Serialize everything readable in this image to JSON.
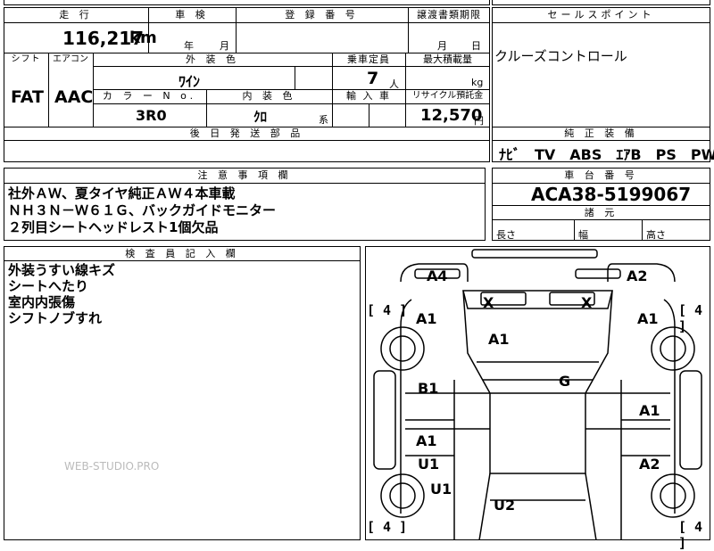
{
  "header": {
    "mileage_label": "走 行",
    "inspection_label": "車 検",
    "registration_label": "登 録 番 号",
    "transfer_deadline_label": "譲渡書類期限",
    "sales_point_label": "セールスポイント"
  },
  "values": {
    "mileage": "116,217",
    "mileage_unit": "km",
    "inspection_year_unit": "年",
    "inspection_month_unit": "月",
    "transfer_month_unit": "月",
    "transfer_day_unit": "日",
    "sales_point": "クルーズコントロール"
  },
  "row2": {
    "shift_label": "シフト",
    "aircon_label": "エアコン",
    "exterior_color_label": "外 装 色",
    "capacity_label": "乗車定員",
    "max_load_label": "最大積載量",
    "shift": "FAT",
    "aircon": "AAC",
    "exterior_color": "ﾜｲﾝ",
    "capacity": "7",
    "capacity_unit": "人",
    "max_load_unit": "kg",
    "color_no_label": "カ ラ ー N o.",
    "interior_color_label": "内 装 色",
    "import_label": "輸 入 車",
    "recycle_label": "リサイクル預託金",
    "color_no": "3R0",
    "interior_color": "ｸﾛ",
    "interior_suffix": "系",
    "recycle_fee": "12,570",
    "recycle_unit": "円"
  },
  "parts": {
    "label": "後 日 発 送 部 品",
    "genuine_label": "純 正 装 備",
    "genuine_items": "ﾅﾋﾞ　TV　ABS　ｴｱB　PS　PW"
  },
  "notes": {
    "label": "注 意 事 項 欄",
    "lines": [
      "社外ＡＷ、夏タイヤ純正ＡＷ４本車載",
      "ＮＨ３Ｎ－Ｗ６１Ｇ、バックガイドモニター",
      "２列目シートヘッドレスト1個欠品"
    ]
  },
  "chassis": {
    "label": "車 台 番 号",
    "number": "ACA38-5199067",
    "dims_label": "諸 元",
    "length_label": "長さ",
    "width_label": "幅",
    "height_label": "高さ"
  },
  "inspector": {
    "label": "検 査 員 記 入 欄",
    "lines": [
      "外装うすい線キズ",
      "シートへたり",
      "室内内張傷",
      "シフトノブすれ"
    ]
  },
  "watermark": "WEB-STUDIO.PRO",
  "diagram": {
    "marks": [
      {
        "id": "a4-top-left",
        "text": "A4"
      },
      {
        "id": "a2-top-right",
        "text": "A2"
      },
      {
        "id": "x-left",
        "text": "X"
      },
      {
        "id": "x-right",
        "text": "X"
      },
      {
        "id": "a1-left-front",
        "text": "A1"
      },
      {
        "id": "a1-right-front",
        "text": "A1"
      },
      {
        "id": "a1-roof",
        "text": "A1"
      },
      {
        "id": "g-windshield",
        "text": "G"
      },
      {
        "id": "b1-left",
        "text": "B1"
      },
      {
        "id": "a1-right-door",
        "text": "A1"
      },
      {
        "id": "a1-left-rear",
        "text": "A1"
      },
      {
        "id": "u1-left-rear",
        "text": "U1"
      },
      {
        "id": "a2-right-rear",
        "text": "A2"
      },
      {
        "id": "u1-left-lower",
        "text": "U1"
      },
      {
        "id": "u2-bottom",
        "text": "U2"
      }
    ],
    "tread": [
      {
        "id": "tread-front-left",
        "text": "[ 4 ]"
      },
      {
        "id": "tread-front-right",
        "text": "[ 4 ]"
      },
      {
        "id": "tread-rear-left",
        "text": "[ 4 ]"
      },
      {
        "id": "tread-rear-right",
        "text": "[ 4 ]"
      }
    ]
  }
}
